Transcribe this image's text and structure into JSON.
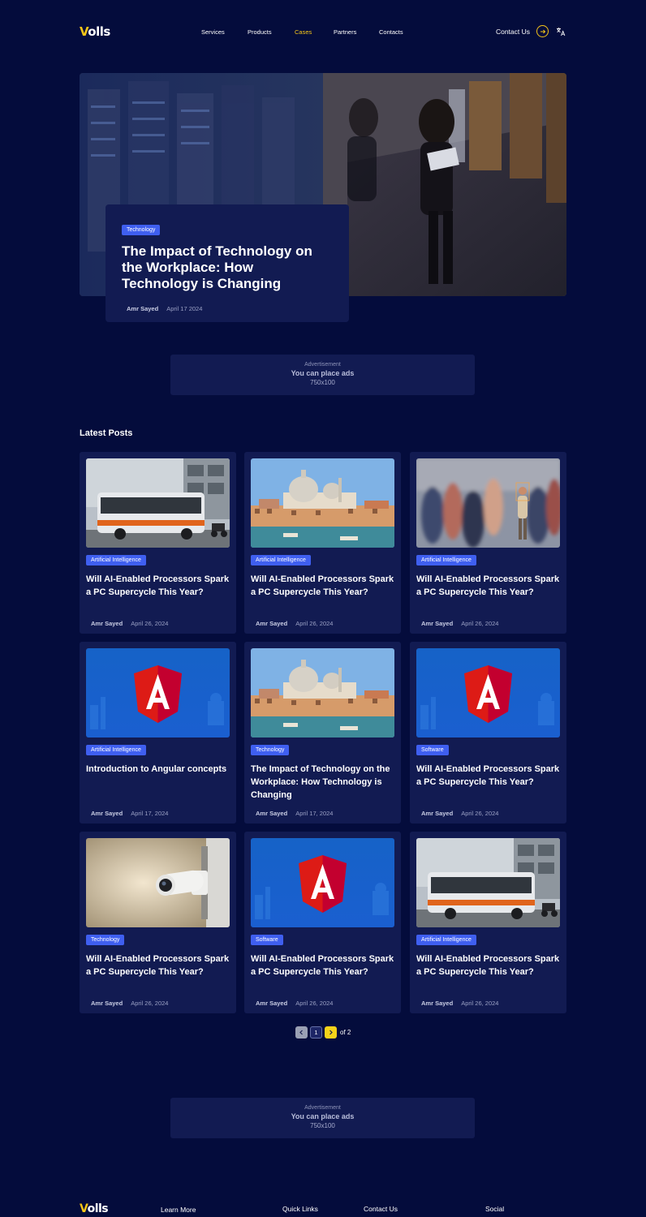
{
  "header": {
    "logo": {
      "first": "V",
      "rest": "olls"
    },
    "nav": [
      "Services",
      "Products",
      "Cases",
      "Partners",
      "Contacts"
    ],
    "active_nav": "Cases",
    "contact": "Contact Us",
    "circle_icon": "arrow-right-icon",
    "lang_icon": "translate-icon"
  },
  "hero": {
    "tag": "Technology",
    "title": "The Impact of Technology on the Workplace: How Technology is Changing",
    "author": "Amr Sayed",
    "date": "April 17 2024"
  },
  "ad_top": {
    "label": "Advertisement",
    "text": "You can place ads",
    "size": "750x100"
  },
  "latest": {
    "title": "Latest Posts",
    "posts": [
      {
        "image": "bus",
        "tag": "Artificial Intelligence",
        "title": "Will AI-Enabled Processors Spark a PC Supercycle This Year?",
        "author": "Amr Sayed",
        "date": "April 26, 2024"
      },
      {
        "image": "venice",
        "tag": "Artificial Intelligence",
        "title": "Will AI-Enabled Processors Spark a PC Supercycle This Year?",
        "author": "Amr Sayed",
        "date": "April 26, 2024"
      },
      {
        "image": "crowd",
        "tag": "Artificial Intelligence",
        "title": "Will AI-Enabled Processors Spark a PC Supercycle This Year?",
        "author": "Amr Sayed",
        "date": "April 26, 2024"
      },
      {
        "image": "angular",
        "tag": "Artificial Intelligence",
        "title": "Introduction to Angular concepts",
        "author": "Amr Sayed",
        "date": "April 17, 2024"
      },
      {
        "image": "venice",
        "tag": "Technology",
        "title": "The Impact of Technology on the Workplace: How Technology is Changing",
        "author": "Amr Sayed",
        "date": "April 17, 2024"
      },
      {
        "image": "angular",
        "tag": "Software",
        "title": "Will AI-Enabled Processors Spark a PC Supercycle This Year?",
        "author": "Amr Sayed",
        "date": "April 26, 2024"
      },
      {
        "image": "camera",
        "tag": "Technology",
        "title": "Will AI-Enabled Processors Spark a PC Supercycle This Year?",
        "author": "Amr Sayed",
        "date": "April 26, 2024"
      },
      {
        "image": "angular",
        "tag": "Software",
        "title": "Will AI-Enabled Processors Spark a PC Supercycle This Year?",
        "author": "Amr Sayed",
        "date": "April 26, 2024"
      },
      {
        "image": "bus",
        "tag": "Artificial Intelligence",
        "title": "Will AI-Enabled Processors Spark a PC Supercycle This Year?",
        "author": "Amr Sayed",
        "date": "April 26, 2024"
      }
    ]
  },
  "pagination": {
    "prev_icon": "chevron-left-icon",
    "current": "1",
    "next_icon": "chevron-right-icon",
    "of": "of 2"
  },
  "ad_bottom": {
    "label": "Advertisement",
    "text": "You can place ads",
    "size": "750x100"
  },
  "footer": {
    "logo": {
      "first": "V",
      "rest": "olls"
    },
    "columns": [
      "Learn More",
      "Quick Links",
      "Contact Us",
      "Social"
    ]
  },
  "colors": {
    "background": "#040c3c",
    "card": "#121b52",
    "accent": "#f5c518",
    "tag": "#3f5ff0"
  }
}
